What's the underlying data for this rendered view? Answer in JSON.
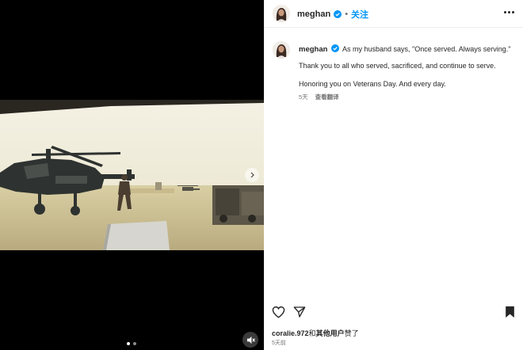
{
  "header": {
    "username": "meghan",
    "separator": "•",
    "follow_label": "关注"
  },
  "caption": {
    "username": "meghan",
    "line1": "As my husband says, \"Once served. Always serving.\"",
    "line2": "Thank you to all who served, sacrificed, and continue to serve.",
    "line3": "Honoring you on Veterans Day. And every day.",
    "time_ago": "5天",
    "translate_label": "查看翻译"
  },
  "actions": {
    "icons": [
      "heart-icon",
      "share-icon",
      "bookmark-icon"
    ]
  },
  "likes": {
    "user": "coralie.972",
    "joiner": "和",
    "others": "其他用户",
    "suffix": "赞了"
  },
  "post_date": "5天前",
  "media": {
    "slide_count": 2,
    "active_slide": 1,
    "mute_icon": "speaker-muted-icon",
    "next_icon": "chevron-right-icon"
  },
  "colors": {
    "accent": "#0095f6",
    "verified": "#0095f6",
    "text": "#262626",
    "muted": "#737373"
  }
}
